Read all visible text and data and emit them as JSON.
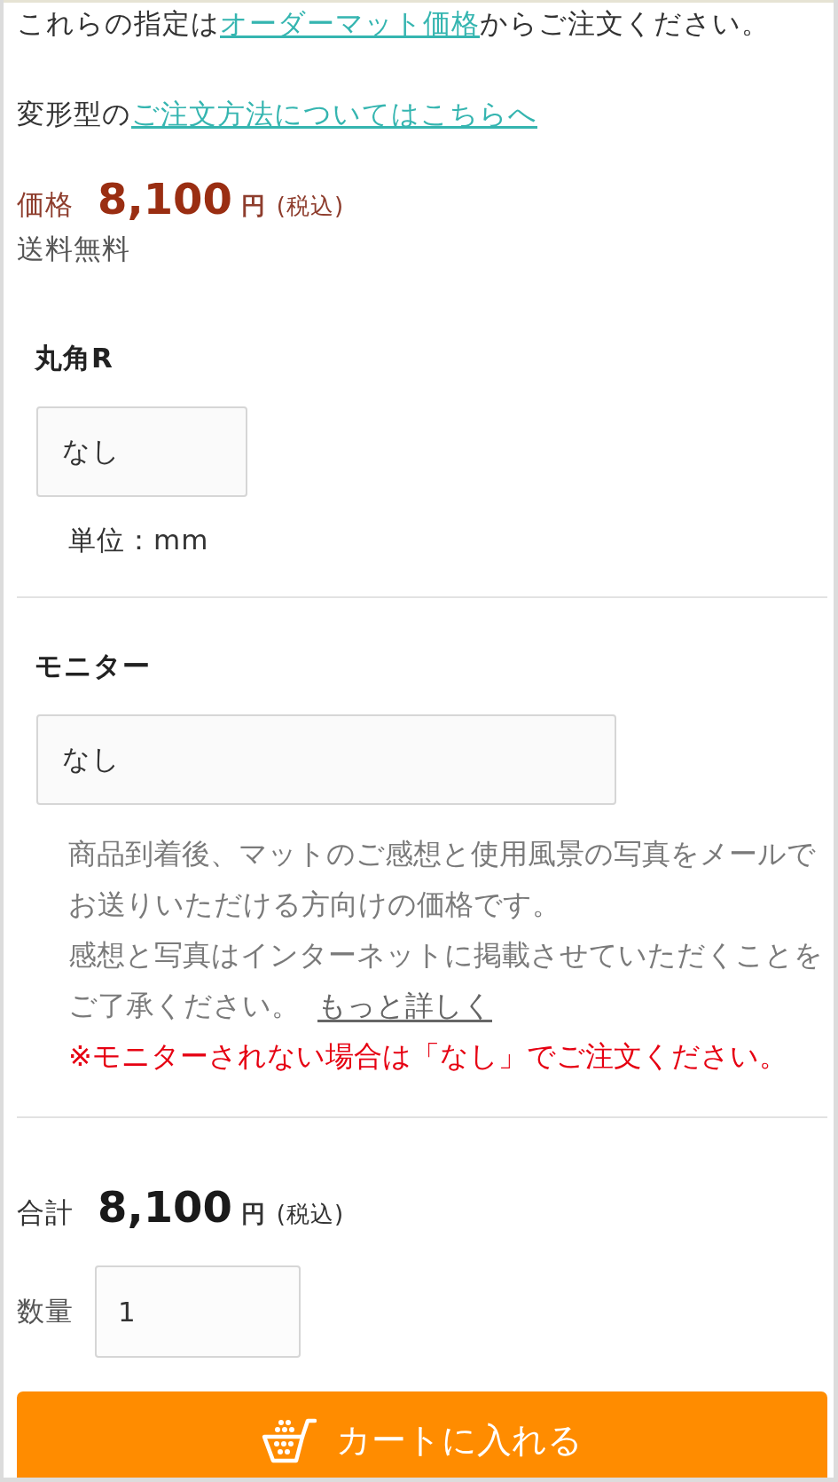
{
  "intro": {
    "before": "これらの指定は",
    "link": "オーダーマット価格",
    "after": "からご注文ください。"
  },
  "order_guide": {
    "before": "変形型の",
    "link": "ご注文方法についてはこちらへ"
  },
  "price": {
    "label": "価格",
    "amount": "8,100",
    "currency": "円",
    "tax_note": "(税込)",
    "shipping": "送料無料"
  },
  "corner_radius": {
    "label": "丸角R",
    "value": "なし",
    "unit": "単位：mm"
  },
  "monitor": {
    "label": "モニター",
    "value": "なし",
    "notes": [
      "商品到着後、マットのご感想と使用風景の写真をメールでお送りいただける方向けの価格です。",
      "感想と写真はインターネットに掲載させていただくことをご了承ください。"
    ],
    "more_link": "もっと詳しく",
    "warning": "※モニターされない場合は「なし」でご注文ください。"
  },
  "total": {
    "label": "合計",
    "amount": "8,100",
    "currency": "円",
    "tax_note": "(税込)"
  },
  "quantity": {
    "label": "数量",
    "value": "1"
  },
  "cart_button": {
    "label": "カートに入れる"
  }
}
